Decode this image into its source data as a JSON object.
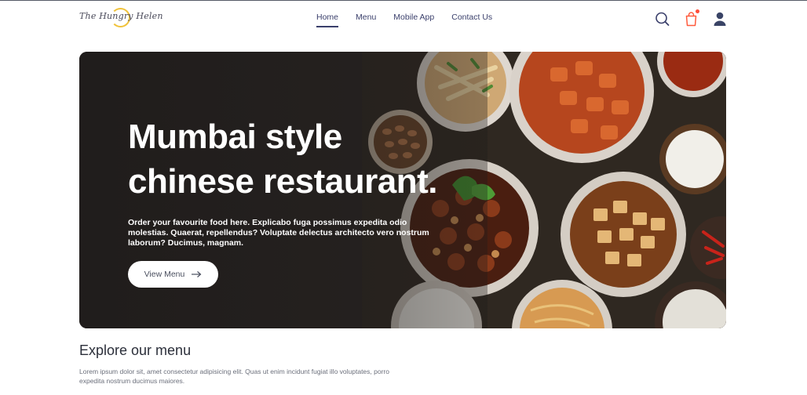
{
  "brand": {
    "logo_text": "The Hungry Helen"
  },
  "nav": {
    "items": [
      {
        "label": "Home",
        "active": true
      },
      {
        "label": "Menu",
        "active": false
      },
      {
        "label": "Mobile App",
        "active": false
      },
      {
        "label": "Contact Us",
        "active": false
      }
    ]
  },
  "header_icons": {
    "search": "search-icon",
    "cart": "shopping-bag-icon",
    "cart_has_notification": true,
    "user": "user-icon"
  },
  "hero": {
    "title": "Mumbai style chinese restaurant.",
    "description": "Order your favourite food here. Explicabo fuga possimus expedita odio molestias. Quaerat, repellendus? Voluptate delectus architecto vero nostrum laborum? Ducimus, magnam.",
    "cta_label": "View Menu",
    "cta_icon": "arrow-right-icon"
  },
  "explore": {
    "title": "Explore our menu",
    "description": "Lorem ipsum dolor sit, amet consectetur adipisicing elit. Quas ut enim incidunt fugiat illo voluptates, porro expedita nostrum ducimus maiores."
  },
  "colors": {
    "nav_text": "#3a3f6b",
    "cart_icon": "#ff5a3c",
    "notification_dot": "#ff4d3a",
    "logo_accent": "#f0c23a",
    "user_icon": "#3a4466"
  }
}
